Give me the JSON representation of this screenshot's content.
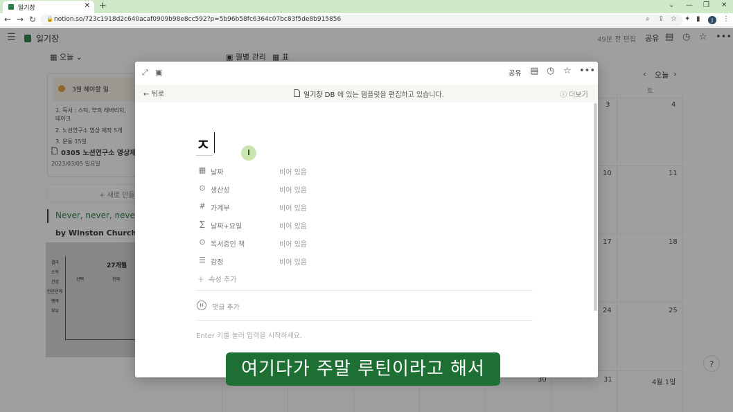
{
  "browser": {
    "tab_title": "일기장",
    "url": "notion.so/723c1918d2c640acaf0909b98e8cc592?p=5b96b58fc6364c07bc83f5de8b915856",
    "profile_initial": "J"
  },
  "header": {
    "page_title": "일기장",
    "edited": "49분 전 편집",
    "share": "공유"
  },
  "views": {
    "today": "오늘",
    "monthly": "월별 관리",
    "table": "표"
  },
  "card": {
    "highlight_title": "3월 헤야할 일",
    "items": [
      "1.   독서 : 스틱, 부의 레버리지,",
      "       테이크",
      "2.   노션연구소 영상 제작 5개",
      "3.   운동 15일"
    ],
    "entry_title": "0305 노션연구소 영상제작",
    "entry_date": "2023/03/05 일요일",
    "new_label": "+ 새로 만들기"
  },
  "quote": {
    "text": "Never, never, never",
    "author": "by Winston Churchill"
  },
  "chart_image": {
    "title": "27개월",
    "labels": [
      "결과",
      "소득",
      "건강",
      "인간관계",
      "행복",
      "부유"
    ],
    "legend": [
      "선택",
      "현재"
    ]
  },
  "calendar": {
    "today_button": "오늘",
    "dow": "토",
    "numbers": [
      "3",
      "4",
      "10",
      "11",
      "17",
      "18",
      "24",
      "25",
      "30",
      "31",
      "4월 1일"
    ]
  },
  "modal": {
    "share": "공유",
    "back": "뒤로",
    "template_db": "일기장 DB",
    "template_msg": "에 있는 템플릿을 편집하고 있습니다.",
    "more": "더보기",
    "heading": "ㅈ",
    "cursor_badge": "I",
    "properties": [
      {
        "name": "날짜",
        "value": "비어 있음",
        "icon": "calendar-icon",
        "glyph": "▦"
      },
      {
        "name": "생산성",
        "value": "비어 있음",
        "icon": "select-icon",
        "glyph": "⊙"
      },
      {
        "name": "가계부",
        "value": "비어 있음",
        "icon": "number-icon",
        "glyph": "#"
      },
      {
        "name": "날짜+요일",
        "value": "비어 있음",
        "icon": "formula-icon",
        "glyph": "∑"
      },
      {
        "name": "독서중인 책",
        "value": "비어 있음",
        "icon": "select-icon",
        "glyph": "⊙"
      },
      {
        "name": "감정",
        "value": "비어 있음",
        "icon": "list-icon",
        "glyph": "☰"
      }
    ],
    "add_property": "속성 추가",
    "add_comment": "댓글 추가",
    "comment_icon": "H",
    "placeholder": "Enter 키를 눌러 입력을 시작하세요."
  },
  "subtitle": "여기다가 주말 루틴이라고 해서",
  "help": "?"
}
